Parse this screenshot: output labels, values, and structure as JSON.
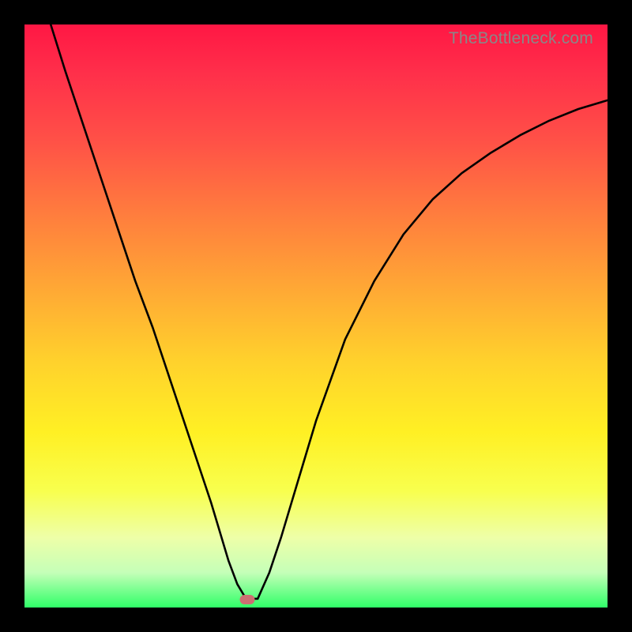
{
  "watermark": "TheBottleneck.com",
  "chart_data": {
    "type": "line",
    "title": "",
    "xlabel": "",
    "ylabel": "",
    "xlim": [
      0,
      100
    ],
    "ylim": [
      0,
      100
    ],
    "grid": false,
    "legend": false,
    "background": "red-yellow-green-vertical-gradient",
    "series": [
      {
        "name": "bottleneck-curve",
        "color": "#000000",
        "x": [
          4.5,
          7,
          10,
          13,
          16,
          19,
          22,
          25,
          28,
          30,
          32,
          33.5,
          35,
          36.5,
          38,
          40,
          42,
          44,
          47,
          50,
          55,
          60,
          65,
          70,
          75,
          80,
          85,
          90,
          95,
          100
        ],
        "y": [
          100,
          92,
          83,
          74,
          65,
          56,
          48,
          39,
          30,
          24,
          18,
          13,
          8,
          4,
          1.5,
          1.5,
          6,
          12,
          22,
          32,
          46,
          56,
          64,
          70,
          74.5,
          78,
          81,
          83.5,
          85.5,
          87
        ]
      }
    ],
    "marker": {
      "x_pct": 38.2,
      "y_pct_from_top": 98.6,
      "color": "#cc6f72"
    }
  }
}
